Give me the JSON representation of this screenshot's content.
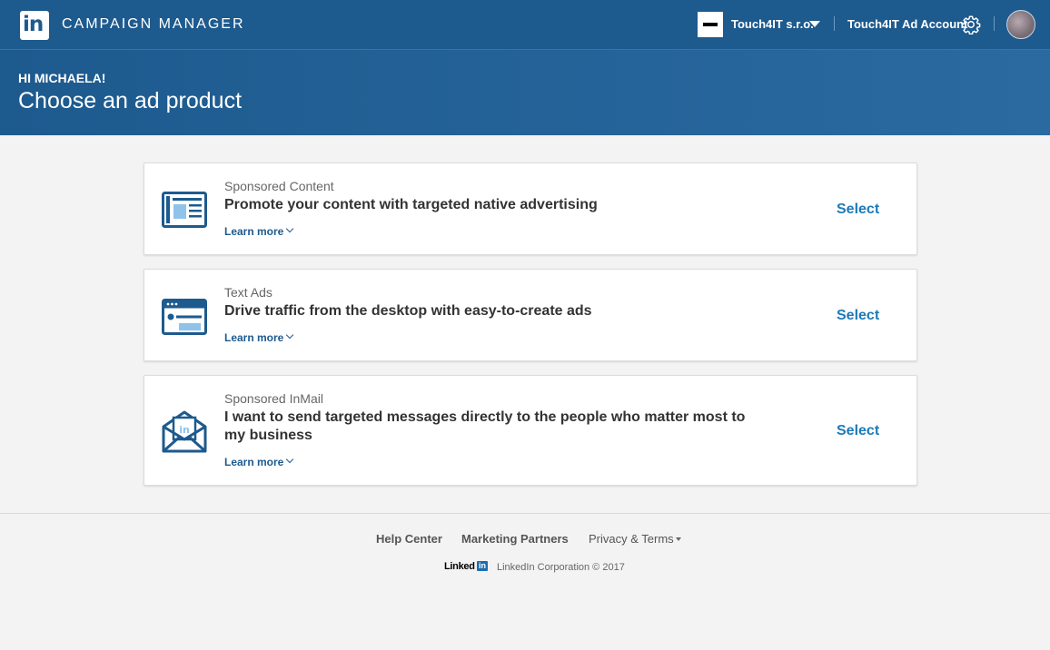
{
  "topbar": {
    "logo_text": "in",
    "app_title": "CAMPAIGN MANAGER",
    "company_name": "Touch4IT s.r.o.",
    "ad_account_label": "Touch4IT Ad Account"
  },
  "header": {
    "greeting": "HI MICHAELA!",
    "title": "Choose an ad product"
  },
  "products": [
    {
      "kicker": "Sponsored Content",
      "description": "Promote your content with targeted native advertising",
      "learn_more": "Learn more",
      "select_label": "Select",
      "icon": "newspaper-icon"
    },
    {
      "kicker": "Text Ads",
      "description": "Drive traffic from the desktop with easy-to-create ads",
      "learn_more": "Learn more",
      "select_label": "Select",
      "icon": "browser-window-icon"
    },
    {
      "kicker": "Sponsored InMail",
      "description": "I want to send targeted messages directly to the people who matter most to my business",
      "learn_more": "Learn more",
      "select_label": "Select",
      "icon": "envelope-icon"
    }
  ],
  "footer": {
    "help_center": "Help Center",
    "marketing_partners": "Marketing Partners",
    "privacy_terms": "Privacy & Terms",
    "brand_word": "Linked",
    "brand_badge": "in",
    "copyright": "LinkedIn Corporation © 2017"
  },
  "colors": {
    "brand_blue": "#1d5a8e",
    "link_blue": "#1d7ab8",
    "page_background": "#f3f3f3"
  }
}
